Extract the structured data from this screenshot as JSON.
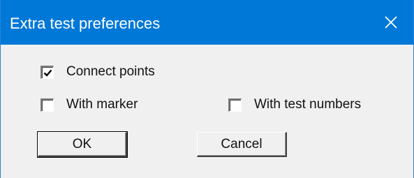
{
  "window": {
    "title": "Extra test preferences",
    "close_icon": "close-icon"
  },
  "options": {
    "connect_points": {
      "label": "Connect points",
      "checked": true
    },
    "with_marker": {
      "label": "With marker",
      "checked": false
    },
    "with_test_numbers": {
      "label": "With test numbers",
      "checked": false
    }
  },
  "buttons": {
    "ok_label": "OK",
    "cancel_label": "Cancel"
  },
  "colors": {
    "titlebar": "#0078d7",
    "dialog_bg": "#f0f0f0"
  }
}
